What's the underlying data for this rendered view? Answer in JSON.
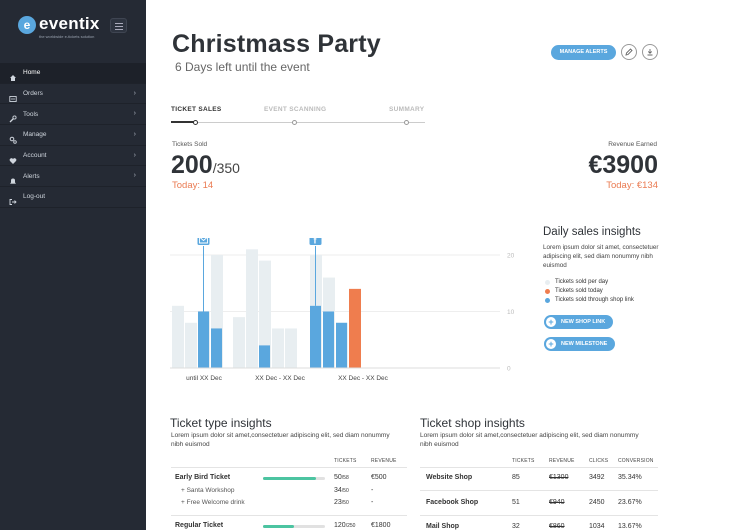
{
  "app": {
    "logo_mark": "e",
    "name": "eventix",
    "tagline": "the worldwide e-tickets solution"
  },
  "sidebar": {
    "items": [
      {
        "label": "Home",
        "icon": "home-icon",
        "has_children": false,
        "active": true
      },
      {
        "label": "Orders",
        "icon": "orders-icon",
        "has_children": true
      },
      {
        "label": "Tools",
        "icon": "wrench-icon",
        "has_children": true
      },
      {
        "label": "Manage",
        "icon": "gears-icon",
        "has_children": true
      },
      {
        "label": "Account",
        "icon": "heart-icon",
        "has_children": true
      },
      {
        "label": "Alerts",
        "icon": "bell-icon",
        "has_children": true
      },
      {
        "label": "Log-out",
        "icon": "logout-icon",
        "has_children": false
      }
    ],
    "chevron": "›"
  },
  "header": {
    "title": "Christmass Party",
    "subtitle": "6 Days left until the event",
    "manage_alerts": "MANAGE ALERTS"
  },
  "steps": {
    "items": [
      "TICKET SALES",
      "EVENT SCANNING",
      "SUMMARY"
    ],
    "active": 0
  },
  "kpis": {
    "tickets_label": "Tickets Sold",
    "tickets_sold": "200",
    "tickets_total": "/350",
    "tickets_today": "Today: 14",
    "revenue_label": "Revenue Earned",
    "revenue": "€3900",
    "revenue_today": "Today: €134"
  },
  "chart_data": {
    "type": "bar",
    "categories": [
      "until XX Dec",
      "XX Dec - XX Dec",
      "XX Dec - XX Dec"
    ],
    "y_ticks": [
      0,
      10,
      20
    ],
    "ylim": [
      0,
      23
    ],
    "grid": true,
    "series": [
      {
        "name": "Tickets sold per day",
        "color": "#e8eef1",
        "values": [
          11,
          8,
          10,
          20,
          9,
          21,
          19,
          7,
          7,
          20,
          16,
          8,
          9
        ]
      },
      {
        "name": "Tickets sold through shop link",
        "color": "#5aa7de",
        "values": [
          null,
          null,
          10,
          7,
          null,
          null,
          4,
          null,
          null,
          11,
          10,
          8,
          null
        ]
      },
      {
        "name": "Tickets sold today",
        "color": "#ef7d4e",
        "values": [
          null,
          null,
          null,
          null,
          null,
          null,
          null,
          null,
          null,
          null,
          null,
          null,
          14
        ]
      }
    ],
    "markers": [
      {
        "bar": 2,
        "icon": "mail-icon",
        "value": 23
      },
      {
        "bar": 9,
        "icon": "facebook-icon",
        "value": 23
      }
    ]
  },
  "insights": {
    "title": "Daily sales insights",
    "desc": "Lorem ipsum dolor sit amet, consectetuer adipiscing elit, sed diam nonummy nibh euismod",
    "legend": [
      {
        "label": "Tickets sold per day",
        "color": "#e8eef1"
      },
      {
        "label": "Tickets sold today",
        "color": "#ef7d4e"
      },
      {
        "label": "Tickets sold through shop link",
        "color": "#5aa7de"
      }
    ],
    "new_shop_link": "NEW SHOP LINK",
    "new_milestone": "NEW MILESTONE"
  },
  "ticket_type": {
    "title": "Ticket type insights",
    "desc": "Lorem ipsum dolor sit amet,consectetuer adipiscing elit, sed diam nonummy nibh euismod",
    "headers": [
      "TICKETS",
      "REVENUE"
    ],
    "rows": [
      {
        "name": "Early Bird Ticket",
        "progress": 0.86,
        "tickets": "50",
        "tickets_total": "/58",
        "revenue": "€500"
      },
      {
        "name": "+ Santa Workshop",
        "sub": true,
        "tickets": "34",
        "tickets_total": "/50",
        "revenue": "-"
      },
      {
        "name": "+ Free Welcome drink",
        "sub": true,
        "tickets": "23",
        "tickets_total": "/50",
        "revenue": "-"
      },
      {
        "name": "Regular Ticket",
        "progress": 0.5,
        "tickets": "120",
        "tickets_total": "/250",
        "revenue": "€1800"
      }
    ]
  },
  "ticket_shop": {
    "title": "Ticket shop insights",
    "desc": "Lorem ipsum dolor sit amet,consectetuer adipiscing elit, sed diam nonummy nibh euismod",
    "headers": [
      "TICKETS",
      "REVENUE",
      "CLICKS",
      "CONVERSION"
    ],
    "rows": [
      {
        "name": "Website Shop",
        "tickets": "85",
        "revenue": "€1300",
        "clicks": "3492",
        "conversion": "35.34%"
      },
      {
        "name": "Facebook Shop",
        "tickets": "51",
        "revenue": "€940",
        "clicks": "2450",
        "conversion": "23.67%"
      },
      {
        "name": "Mail Shop",
        "tickets": "32",
        "revenue": "€860",
        "clicks": "1034",
        "conversion": "13.67%"
      }
    ]
  }
}
